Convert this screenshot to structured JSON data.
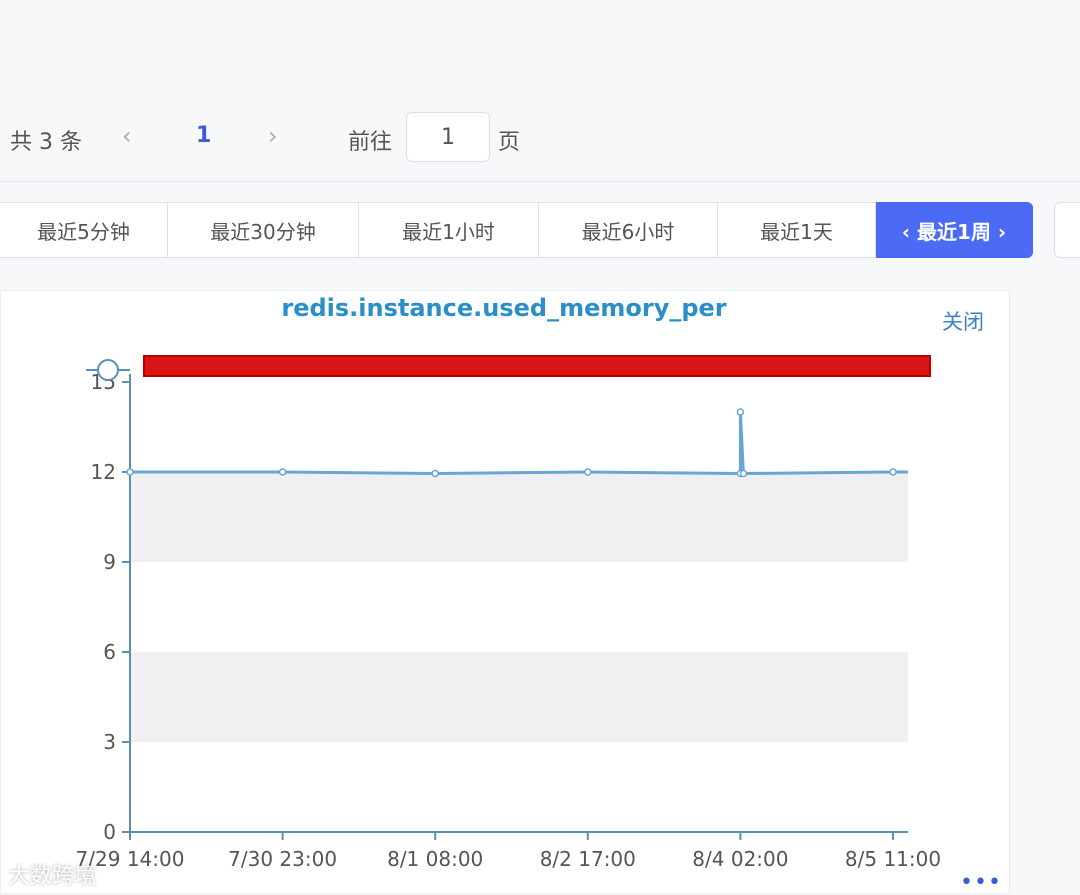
{
  "pagination": {
    "total_label": "共 3 条",
    "prev_icon": "‹",
    "current_page": "1",
    "next_icon": "›",
    "goto_label": "前往",
    "goto_value": "1",
    "page_unit": "页"
  },
  "time_ranges": [
    {
      "label": "最近5分钟",
      "active": false
    },
    {
      "label": "最近30分钟",
      "active": false
    },
    {
      "label": "最近1小时",
      "active": false
    },
    {
      "label": "最近6小时",
      "active": false
    },
    {
      "label": "最近1天",
      "active": false
    },
    {
      "label": "‹ 最近1周 ›",
      "active": true
    }
  ],
  "chart_panel": {
    "close_label": "关闭",
    "more_icon": "•••"
  },
  "watermark": "大数跨境",
  "colors": {
    "accent": "#4b6bf5",
    "series": "#6aa6d4",
    "title": "#2a8fc8",
    "axis": "#5d8fb3"
  },
  "chart_data": {
    "type": "line",
    "title": "redis.instance.used_memory_per",
    "x_ticks": [
      "7/29 14:00",
      "7/30 23:00",
      "8/1 08:00",
      "8/2 17:00",
      "8/4 02:00",
      "8/5 11:00"
    ],
    "y_ticks": [
      "0",
      "3",
      "6",
      "9",
      "12",
      "15"
    ],
    "ylim": [
      0,
      15
    ],
    "grid": "alternating bands",
    "series": [
      {
        "x": [
          "7/29 14:00",
          "7/30 23:00",
          "8/1 08:00",
          "8/2 17:00",
          "8/4 02:00",
          "8/4 03:00",
          "8/4 04:00",
          "8/5 11:00"
        ],
        "values": [
          12,
          12,
          11.95,
          12,
          11.95,
          14,
          11.95,
          12
        ]
      }
    ]
  }
}
